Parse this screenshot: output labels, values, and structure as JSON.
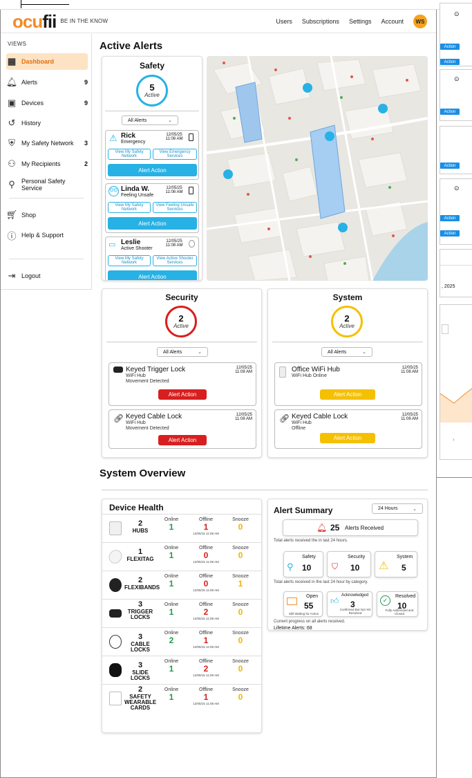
{
  "brand": {
    "logo_main": "ocu",
    "logo_accent": "fii",
    "tagline": "BE IN THE KNOW"
  },
  "nav": {
    "items": [
      "Users",
      "Subscriptions",
      "Settings",
      "Account"
    ],
    "avatar": "WS"
  },
  "sidebar": {
    "section": "VIEWS",
    "items": [
      {
        "label": "Dashboard",
        "count": "",
        "icon": "dashboard-icon"
      },
      {
        "label": "Alerts",
        "count": "9",
        "icon": "bell-icon"
      },
      {
        "label": "Devices",
        "count": "9",
        "icon": "chip-icon"
      },
      {
        "label": "History",
        "count": "",
        "icon": "history-icon"
      },
      {
        "label": "My Safety Network",
        "count": "3",
        "icon": "shield-icon"
      },
      {
        "label": "My Recipients",
        "count": "2",
        "icon": "people-icon"
      },
      {
        "label": "Personal Safety Service",
        "count": "",
        "icon": "person-check-icon"
      },
      {
        "label": "Shop",
        "count": "",
        "icon": "cart-icon"
      },
      {
        "label": "Help & Support",
        "count": "",
        "icon": "help-icon"
      },
      {
        "label": "Logout",
        "count": "",
        "icon": "logout-icon"
      }
    ]
  },
  "active_alerts": {
    "title": "Active Alerts",
    "safety": {
      "title": "Safety",
      "count": "5",
      "status": "Active",
      "filter": "All Alerts",
      "alerts": [
        {
          "name": "Rick",
          "type": "Emergency",
          "date": "12/05/25",
          "time": "11:08 AM",
          "btn1": "View My Safety Network",
          "btn2": "View Emergency Services",
          "action": "Alert Action"
        },
        {
          "name": "Linda W.",
          "type": "Feeling Unsafe",
          "date": "12/05/25",
          "time": "11:08 AM",
          "btn1": "View My Safety Network",
          "btn2": "View Feeling Unsafe Services",
          "action": "Alert Action"
        },
        {
          "name": "Leslie",
          "type": "Active Shooter",
          "date": "12/05/25",
          "time": "11:08 AM",
          "btn1": "View My Safety Network",
          "btn2": "View Active Shooter Services",
          "action": "Alert Action"
        }
      ]
    },
    "security": {
      "title": "Security",
      "count": "2",
      "status": "Active",
      "filter": "All Alerts",
      "alerts": [
        {
          "name": "Keyed Trigger Lock",
          "hub": "WiFi Hub",
          "detail": "Movement Detected",
          "date": "12/05/25",
          "time": "11:08 AM",
          "action": "Alert Action"
        },
        {
          "name": "Keyed Cable Lock",
          "hub": "WiFi Hub",
          "detail": "Movement Detected",
          "date": "12/05/25",
          "time": "11:08 AM",
          "action": "Alert Action"
        }
      ]
    },
    "system": {
      "title": "System",
      "count": "2",
      "status": "Active",
      "filter": "All Alerts",
      "alerts": [
        {
          "name": "Office WiFi Hub",
          "hub": "WiFi Hub Online",
          "detail": "",
          "date": "12/05/25",
          "time": "11:08 AM",
          "action": "Alert Action"
        },
        {
          "name": "Keyed Cable Lock",
          "hub": "WiFi Hub",
          "detail": "Offline",
          "date": "12/05/25",
          "time": "11:08 AM",
          "action": "Alert Action"
        }
      ]
    }
  },
  "overview": {
    "title": "System Overview"
  },
  "device_health": {
    "title": "Device Health",
    "labels": {
      "online": "Online",
      "offline": "Offline",
      "snooze": "Snooze"
    },
    "stamp": "12/05/15  11:08 AM",
    "rows": [
      {
        "count": "2",
        "name": "HUBS",
        "online": "1",
        "offline": "1",
        "snooze": "0",
        "offline_color": "red",
        "snooze_color": "yellow"
      },
      {
        "count": "1",
        "name": "FLEXITAG",
        "online": "1",
        "offline": "0",
        "snooze": "0",
        "offline_color": "red",
        "snooze_color": "yellow"
      },
      {
        "count": "2",
        "name": "FLEXIBANDS",
        "online": "1",
        "offline": "0",
        "snooze": "1",
        "offline_color": "red",
        "snooze_color": "yellow"
      },
      {
        "count": "3",
        "name": "TRIGGER LOCKS",
        "online": "1",
        "offline": "2",
        "snooze": "0",
        "offline_color": "red",
        "snooze_color": "yellow"
      },
      {
        "count": "3",
        "name": "CABLE LOCKS",
        "online": "2",
        "offline": "1",
        "snooze": "0",
        "offline_color": "red",
        "snooze_color": "yellow"
      },
      {
        "count": "3",
        "name": "SLIDE LOCKS",
        "online": "1",
        "offline": "2",
        "snooze": "0",
        "offline_color": "red",
        "snooze_color": "yellow"
      },
      {
        "count": "2",
        "name": "SAFETY WEARABLE CARDS",
        "online": "1",
        "offline": "1",
        "snooze": "0",
        "offline_color": "red",
        "snooze_color": "yellow"
      }
    ]
  },
  "alert_summary": {
    "title": "Alert Summary",
    "range": "24 Hours",
    "received": {
      "count": "25",
      "label": "Alerts Received"
    },
    "received_note": "Total alerts received the in last 24 hours.",
    "categories": [
      {
        "label": "Safety",
        "value": "10"
      },
      {
        "label": "Security",
        "value": "10"
      },
      {
        "label": "System",
        "value": "5"
      }
    ],
    "category_note": "Total alerts received in the last 24 hour by category.",
    "progress": [
      {
        "label": "Open",
        "value": "55",
        "sub": "Still Waiting for Action"
      },
      {
        "label": "Acknowledged",
        "value": "3",
        "sub": "Confirmed But Not Yet Resolved"
      },
      {
        "label": "Resolved",
        "value": "10",
        "sub": "Fully Addressed and Closed"
      }
    ],
    "progress_note": "Current progress on all alerts received.",
    "lifetime": "Lifetime Alerts: 68"
  },
  "right_panel": {
    "action_label": "Action",
    "year": ", 2025",
    "chev": "›"
  },
  "colors": {
    "orange": "#f28c28",
    "blue": "#27b1e4",
    "red": "#d81f1f",
    "yellow": "#f5c000",
    "green": "#1f9a4c"
  }
}
